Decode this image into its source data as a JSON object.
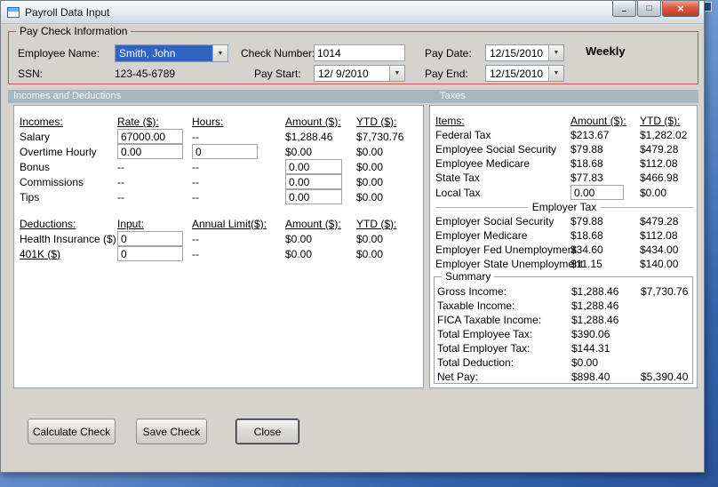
{
  "window": {
    "title": "Payroll Data Input",
    "icons": {
      "minimize": "–",
      "maximize": "□",
      "close": "×",
      "dropdown_arrow": "▼"
    }
  },
  "colors": {
    "selection_blue": "#2f64c2",
    "close_button_red": "#bd3a29",
    "section_header_bg": "#a9b6c0",
    "paycheck_border_red": "#b85b56",
    "window_bg": "#d6d3ce"
  },
  "paycheck": {
    "legend": "Pay Check Information",
    "employee_name": {
      "label": "Employee Name:",
      "value": "Smith, John"
    },
    "ssn": {
      "label": "SSN:",
      "value": "123-45-6789"
    },
    "check_number": {
      "label": "Check Number:",
      "value": "1014"
    },
    "pay_start": {
      "label": "Pay Start:",
      "value": "12/ 9/2010"
    },
    "pay_date": {
      "label": "Pay Date:",
      "value": "12/15/2010"
    },
    "pay_end": {
      "label": "Pay End:",
      "value": "12/15/2010"
    },
    "frequency": "Weekly"
  },
  "sections": {
    "left": "Incomes and Deductions",
    "right": "Taxes"
  },
  "incomes": {
    "headers": {
      "name": "Incomes:",
      "rate": "Rate ($):",
      "hours": "Hours:",
      "amount": "Amount ($):",
      "ytd": "YTD ($):"
    },
    "rows": [
      {
        "name": "Salary",
        "rate": "67000.00",
        "hours": "--",
        "amount": "$1,288.46",
        "ytd": "$7,730.76"
      },
      {
        "name": "Overtime Hourly",
        "rate": "0.00",
        "hours": "0",
        "amount": "$0.00",
        "ytd": "$0.00"
      },
      {
        "name": "Bonus",
        "rate": "--",
        "hours": "--",
        "amount": "0.00",
        "ytd": "$0.00"
      },
      {
        "name": "Commissions",
        "rate": "--",
        "hours": "--",
        "amount": "0.00",
        "ytd": "$0.00"
      },
      {
        "name": "Tips",
        "rate": "--",
        "hours": "--",
        "amount": "0.00",
        "ytd": "$0.00"
      }
    ]
  },
  "deductions": {
    "headers": {
      "name": "Deductions:",
      "input": "Input:",
      "annual_limit": "Annual Limit($):",
      "amount": "Amount ($):",
      "ytd": "YTD ($):"
    },
    "rows": [
      {
        "name": "Health Insurance  ($)",
        "input": "0",
        "annual_limit": "--",
        "amount": "$0.00",
        "ytd": "$0.00"
      },
      {
        "name": "401K  ($)",
        "input": "0",
        "annual_limit": "--",
        "amount": "$0.00",
        "ytd": "$0.00"
      }
    ]
  },
  "taxes": {
    "headers": {
      "items": "Items:",
      "amount": "Amount ($):",
      "ytd": "YTD ($):"
    },
    "employee_rows": [
      {
        "name": "Federal Tax",
        "amount": "$213.67",
        "ytd": "$1,282.02"
      },
      {
        "name": "Employee Social Security",
        "amount": "$79.88",
        "ytd": "$479.28"
      },
      {
        "name": "Employee Medicare",
        "amount": "$18.68",
        "ytd": "$112.08"
      },
      {
        "name": "State Tax",
        "amount": "$77.83",
        "ytd": "$466.98"
      },
      {
        "name": "Local Tax",
        "amount": "0.00",
        "ytd": "$0.00"
      }
    ],
    "employer_header": "Employer Tax",
    "employer_rows": [
      {
        "name": "Employer Social Security",
        "amount": "$79.88",
        "ytd": "$479.28"
      },
      {
        "name": "Employer Medicare",
        "amount": "$18.68",
        "ytd": "$112.08"
      },
      {
        "name": "Employer Fed Unemployment",
        "amount": "$34.60",
        "ytd": "$434.00"
      },
      {
        "name": "Employer State Unemployment",
        "amount": "$11.15",
        "ytd": "$140.00"
      }
    ]
  },
  "summary": {
    "legend": "Summary",
    "rows": [
      {
        "name": "Gross Income:",
        "amount": "$1,288.46",
        "ytd": "$7,730.76"
      },
      {
        "name": "Taxable Income:",
        "amount": "$1,288.46",
        "ytd": ""
      },
      {
        "name": "FICA Taxable Income:",
        "amount": "$1,288.46",
        "ytd": ""
      },
      {
        "name": "Total Employee Tax:",
        "amount": "$390.06",
        "ytd": ""
      },
      {
        "name": "Total Employer Tax:",
        "amount": "$144.31",
        "ytd": ""
      },
      {
        "name": "Total Deduction:",
        "amount": "$0.00",
        "ytd": ""
      },
      {
        "name": "Net Pay:",
        "amount": "$898.40",
        "ytd": "$5,390.40"
      }
    ]
  },
  "buttons": {
    "calculate": "Calculate Check",
    "save": "Save Check",
    "close": "Close"
  }
}
